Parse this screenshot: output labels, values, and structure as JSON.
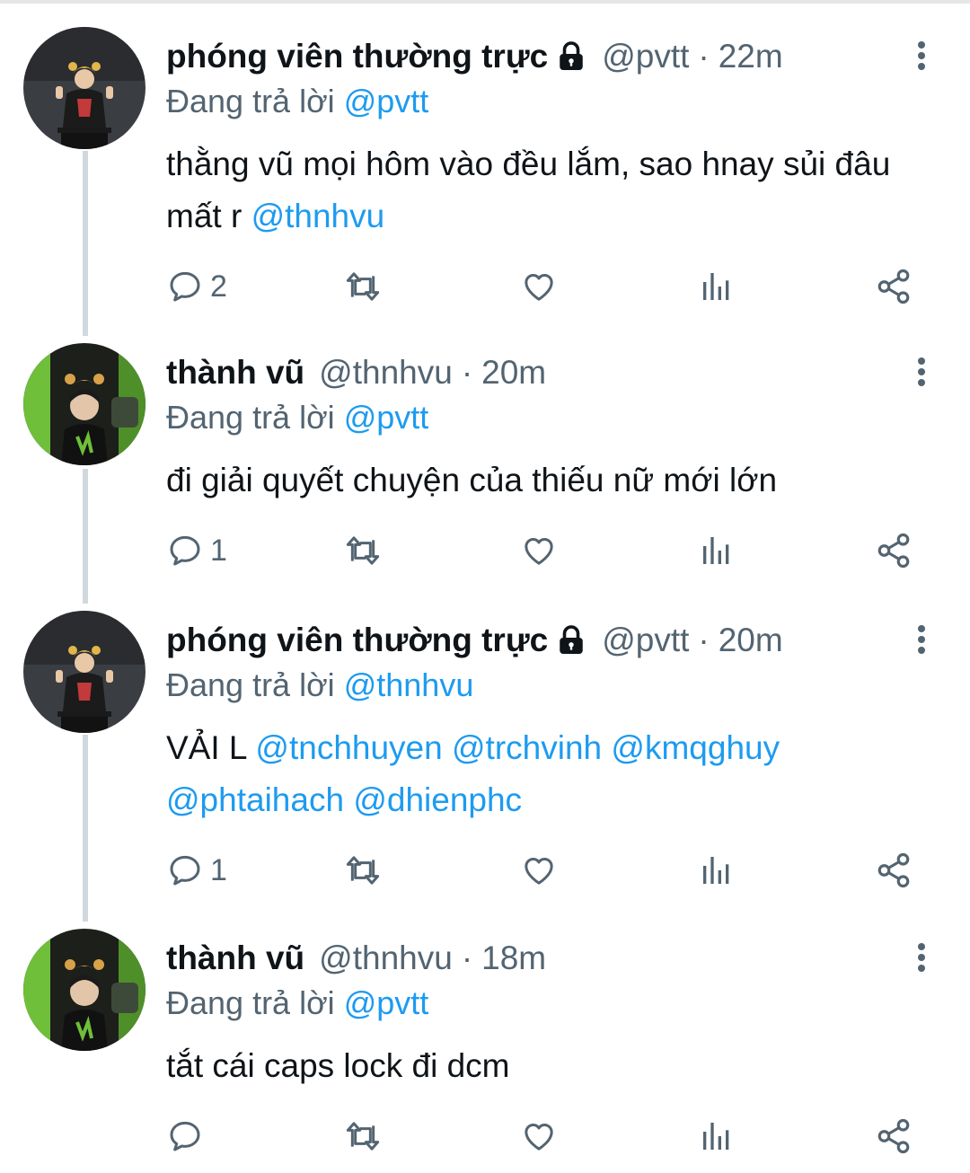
{
  "colors": {
    "text": "#0f1419",
    "secondary": "#536471",
    "link": "#1d9bf0",
    "thread_line": "#cfd9de"
  },
  "tweets": [
    {
      "author": {
        "name": "phóng viên thường trực",
        "handle": "@pvtt",
        "protected": true,
        "avatar": "avatar-pvtt"
      },
      "time": "22m",
      "replying_label": "Đang trả lời",
      "replying_to": "@pvtt",
      "body": {
        "text": "thằng vũ mọi hôm vào đều lắm, sao hnay sủi đâu mất r ",
        "mentions": [
          "@thnhvu"
        ]
      },
      "actions": {
        "reply_count": "2"
      }
    },
    {
      "author": {
        "name": "thành vũ",
        "handle": "@thnhvu",
        "protected": false,
        "avatar": "avatar-thnhvu"
      },
      "time": "20m",
      "replying_label": "Đang trả lời",
      "replying_to": "@pvtt",
      "body": {
        "text": "đi giải quyết chuyện của thiếu nữ mới lớn",
        "mentions": []
      },
      "actions": {
        "reply_count": "1"
      }
    },
    {
      "author": {
        "name": "phóng viên thường trực",
        "handle": "@pvtt",
        "protected": true,
        "avatar": "avatar-pvtt"
      },
      "time": "20m",
      "replying_label": "Đang trả lời",
      "replying_to": "@thnhvu",
      "body": {
        "text": "VẢI L ",
        "mentions": [
          "@tnchhuyen",
          "@trchvinh",
          "@kmqghuy",
          "@phtaihach",
          "@dhienphc"
        ]
      },
      "actions": {
        "reply_count": "1"
      }
    },
    {
      "author": {
        "name": "thành vũ",
        "handle": "@thnhvu",
        "protected": false,
        "avatar": "avatar-thnhvu"
      },
      "time": "18m",
      "replying_label": "Đang trả lời",
      "replying_to": "@pvtt",
      "body": {
        "text": "tắt cái caps lock đi dcm",
        "mentions": []
      },
      "actions": {
        "reply_count": ""
      }
    }
  ],
  "icons": {
    "reply": "reply-icon",
    "retweet": "retweet-icon",
    "like": "like-icon",
    "analytics": "analytics-icon",
    "share": "share-icon",
    "more": "more-icon",
    "lock": "lock-icon"
  }
}
